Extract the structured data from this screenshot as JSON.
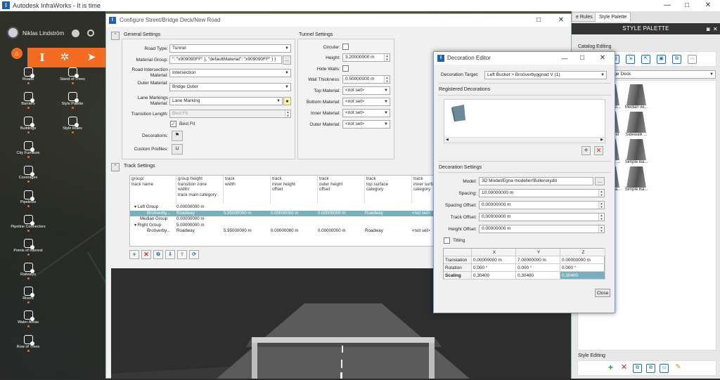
{
  "app": {
    "title": "Autodesk InfraWorks - It is time",
    "logo": "I"
  },
  "user": {
    "name": "Niklas Lindström"
  },
  "left_panel": {
    "tools": [
      {
        "label": "Roads",
        "icon": "road-icon"
      },
      {
        "label": "Stand of Trees",
        "icon": "tree-icon"
      },
      {
        "label": "Barriers",
        "icon": "barrier-icon"
      },
      {
        "label": "Style Palette",
        "icon": "palette-icon"
      },
      {
        "label": "Buildings",
        "icon": "building-icon"
      },
      {
        "label": "Style Rules",
        "icon": "rules-icon"
      },
      {
        "label": "City Furniture",
        "icon": "furniture-icon"
      },
      {
        "label": "Coverages",
        "icon": "coverage-icon"
      },
      {
        "label": "Pipelines",
        "icon": "pipeline-icon"
      },
      {
        "label": "Pipeline Connectors",
        "icon": "connector-icon"
      },
      {
        "label": "Points of Interest",
        "icon": "poi-icon"
      },
      {
        "label": "Railways",
        "icon": "railway-icon"
      },
      {
        "label": "Rivers",
        "icon": "river-icon"
      },
      {
        "label": "Water Areas",
        "icon": "water-icon"
      },
      {
        "label": "Row of Trees",
        "icon": "row-trees-icon"
      }
    ]
  },
  "configure": {
    "title": "Configure Street/Bridge Deck/New Road",
    "general": {
      "title": "General Settings",
      "road_type_label": "Road Type:",
      "road_type": "Tunnel",
      "material_group_label": "Material Group:",
      "material_group": "\": \"x909090FF\" },  \"defaultMaterial\": \"x909090FF\" } }",
      "intersection_label": "Road Intersection Material:",
      "intersection": "Intersection",
      "outer_label": "Outer Material:",
      "outer": "Bridge Outer",
      "lane_label": "Lane Markings Material:",
      "lane": "Lane Marking",
      "transition_label": "Transition Length:",
      "transition": "Best Fit",
      "best_fit_label": "Best Fit",
      "decorations_label": "Decorations:",
      "custom_profiles_label": "Custom Profiles:",
      "ellipsis": "..."
    },
    "tunnel": {
      "title": "Tunnel Settings",
      "circular_label": "Circular:",
      "height_label": "Height:",
      "height": "3.20000000 m",
      "hide_walls_label": "Hide Walls:",
      "wall_label": "Wall Thickness:",
      "wall": "0.50000000 m",
      "top_label": "Top Material:",
      "top": "<not set>",
      "bottom_label": "Bottom Material:",
      "bottom": "<not set>",
      "inner_label": "Inner Material:",
      "inner": "<not set>",
      "outer_label": "Outer Material:",
      "outer": "<not set>"
    },
    "track": {
      "title": "Track Settings",
      "headers": [
        "group/\ntrack name",
        "group height\ntransition zone\nwidth/\ntrack main category",
        "track\nwidth",
        "track\ninner height\noffset",
        "track\nouter height\noffset",
        "track\ntop surface\ncategory",
        "track\ninner surface\ncategory"
      ],
      "rows": [
        {
          "cells": [
            "▾  Left Group",
            "0.00000000 m",
            "",
            "",
            "",
            "",
            ""
          ]
        },
        {
          "cells": [
            "Broöverby...",
            "Roadway",
            "5.95000000 m",
            "0.00000000 m",
            "0.00000000 m",
            "Roadway",
            "<not set>"
          ]
        },
        {
          "cells": [
            "Median Group",
            "0.00000000 m",
            "",
            "",
            "",
            "",
            ""
          ]
        },
        {
          "cells": [
            "▾  Right Group",
            "5.00000000 m",
            "",
            "",
            "",
            "",
            ""
          ]
        },
        {
          "cells": [
            "Broöverby...",
            "Roadway",
            "5.95000000 m",
            "0.00000000 m",
            "0.00000000 m",
            "Roadway",
            "<not set>"
          ]
        }
      ]
    }
  },
  "palette": {
    "tabs": [
      "e Rules",
      "Style Palette"
    ],
    "header": "STYLE PALETTE",
    "catalog_editing": "Catalog Editing",
    "dropdown": "lge Deck",
    "style_editing": "Style Editing",
    "thumbs": [
      [
        "otBridge",
        "Median Si...",
        "Median wi..."
      ],
      [
        "edian wi...",
        "Red Steel",
        "Sidewalk ..."
      ],
      [
        "ewalk ...",
        "Sidewalk ...",
        "Simple Ba..."
      ],
      [
        "imple Ba...",
        "Simple Ba...",
        "Simple Ba..."
      ]
    ]
  },
  "decoration": {
    "title": "Decoration Editor",
    "target_label": "Decoration Target:",
    "target": "Left Bucket > Broöverbyggnad V (1)",
    "registered": "Registered Decorations",
    "settings": "Decoration Settings",
    "model_label": "Model:",
    "model": "3D Model/Egna modeller/Bullerskydd",
    "model_btn": "...",
    "spacing_label": "Spacing:",
    "spacing": "10.00000000 m",
    "spacing_offset_label": "Spacing Offset:",
    "spacing_offset": "0.00000000 m",
    "track_offset_label": "Track Offset:",
    "track_offset": "0.00000000 m",
    "height_offset_label": "Height Offset:",
    "height_offset": "0.00000000 m",
    "tilting_label": "Tilting",
    "cols": [
      "X",
      "Y",
      "Z"
    ],
    "rows": [
      {
        "name": "Translation",
        "values": [
          "0.00000000 m",
          "7.00000000 m",
          "0.00000000 m"
        ]
      },
      {
        "name": "Rotation",
        "values": [
          "0.000 °",
          "0.000 °",
          "0.000 °"
        ]
      },
      {
        "name": "Scaling",
        "values": [
          "0.30400",
          "0.30400",
          "0.30400"
        ]
      }
    ],
    "close": "Close"
  },
  "colors": {
    "accent": "#f36c21",
    "selection": "#79b0c0",
    "brand": "#1c63a8"
  }
}
